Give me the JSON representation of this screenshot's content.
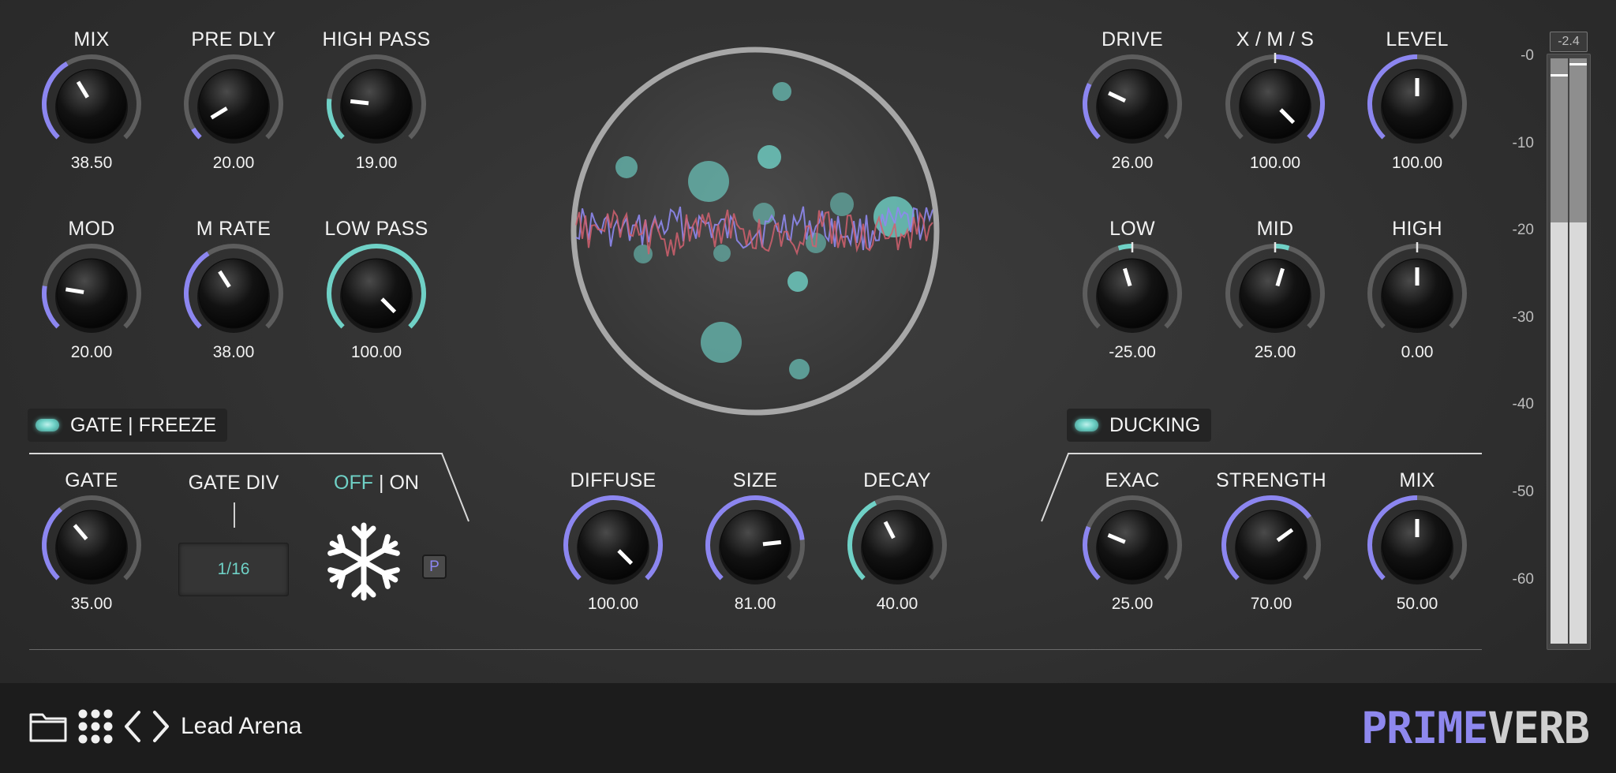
{
  "colors": {
    "accent_purple": "#8c86f0",
    "accent_teal": "#6fd1c6",
    "background": "#2f2f2f",
    "footer": "#1c1c1c"
  },
  "knobs": {
    "mix": {
      "label": "MIX",
      "value": "38.50",
      "accent": "purple",
      "level": 0.385
    },
    "pre_dly": {
      "label": "PRE DLY",
      "value": "20.00",
      "accent": "purple",
      "level": 0.05
    },
    "high_pass": {
      "label": "HIGH PASS",
      "value": "19.00",
      "accent": "teal",
      "level": 0.19
    },
    "mod": {
      "label": "MOD",
      "value": "20.00",
      "accent": "purple",
      "level": 0.2
    },
    "m_rate": {
      "label": "M RATE",
      "value": "38.00",
      "accent": "purple",
      "level": 0.38
    },
    "low_pass": {
      "label": "LOW PASS",
      "value": "100.00",
      "accent": "teal",
      "level": 1.0
    },
    "drive": {
      "label": "DRIVE",
      "value": "26.00",
      "accent": "purple",
      "level": 0.26
    },
    "xms": {
      "label": "X / M / S",
      "value": "100.00",
      "accent": "purple",
      "level": 1.0,
      "bipolar": true
    },
    "level": {
      "label": "LEVEL",
      "value": "100.00",
      "accent": "purple",
      "level": 0.5
    },
    "low": {
      "label": "LOW",
      "value": "-25.00",
      "accent": "teal",
      "level": -0.125,
      "bipolar": true
    },
    "mid": {
      "label": "MID",
      "value": "25.00",
      "accent": "teal",
      "level": 0.125,
      "bipolar": true
    },
    "high": {
      "label": "HIGH",
      "value": "0.00",
      "accent": "teal",
      "level": 0.0,
      "bipolar": true
    },
    "gate": {
      "label": "GATE",
      "value": "35.00",
      "accent": "purple",
      "level": 0.35
    },
    "diffuse": {
      "label": "DIFFUSE",
      "value": "100.00",
      "accent": "purple",
      "level": 1.0
    },
    "size": {
      "label": "SIZE",
      "value": "81.00",
      "accent": "purple",
      "level": 0.81
    },
    "decay": {
      "label": "DECAY",
      "value": "40.00",
      "accent": "teal",
      "level": 0.4
    },
    "exac": {
      "label": "EXAC",
      "value": "25.00",
      "accent": "purple",
      "level": 0.25
    },
    "strength": {
      "label": "STRENGTH",
      "value": "70.00",
      "accent": "purple",
      "level": 0.7
    },
    "duck_mix": {
      "label": "MIX",
      "value": "50.00",
      "accent": "purple",
      "level": 0.5
    }
  },
  "gate_section": {
    "button_label": "GATE | FREEZE",
    "gate_div_label": "GATE DIV",
    "gate_div_value": "1/16",
    "toggle_off": "OFF",
    "toggle_sep": " | ",
    "toggle_on": "ON",
    "p_button": "P"
  },
  "ducking_section": {
    "button_label": "DUCKING"
  },
  "meter": {
    "peak_readout": "-2.4",
    "scale": [
      "-0",
      "-10",
      "-20",
      "-30",
      "-40",
      "-50",
      "-60"
    ],
    "level_fraction": 0.72
  },
  "footer": {
    "preset_name": "Lead Arena",
    "logo_part1": "PRIME",
    "logo_part2": "VERB",
    "icons": [
      "folder-icon",
      "grid-icon",
      "chevron-left-icon",
      "chevron-right-icon"
    ]
  }
}
